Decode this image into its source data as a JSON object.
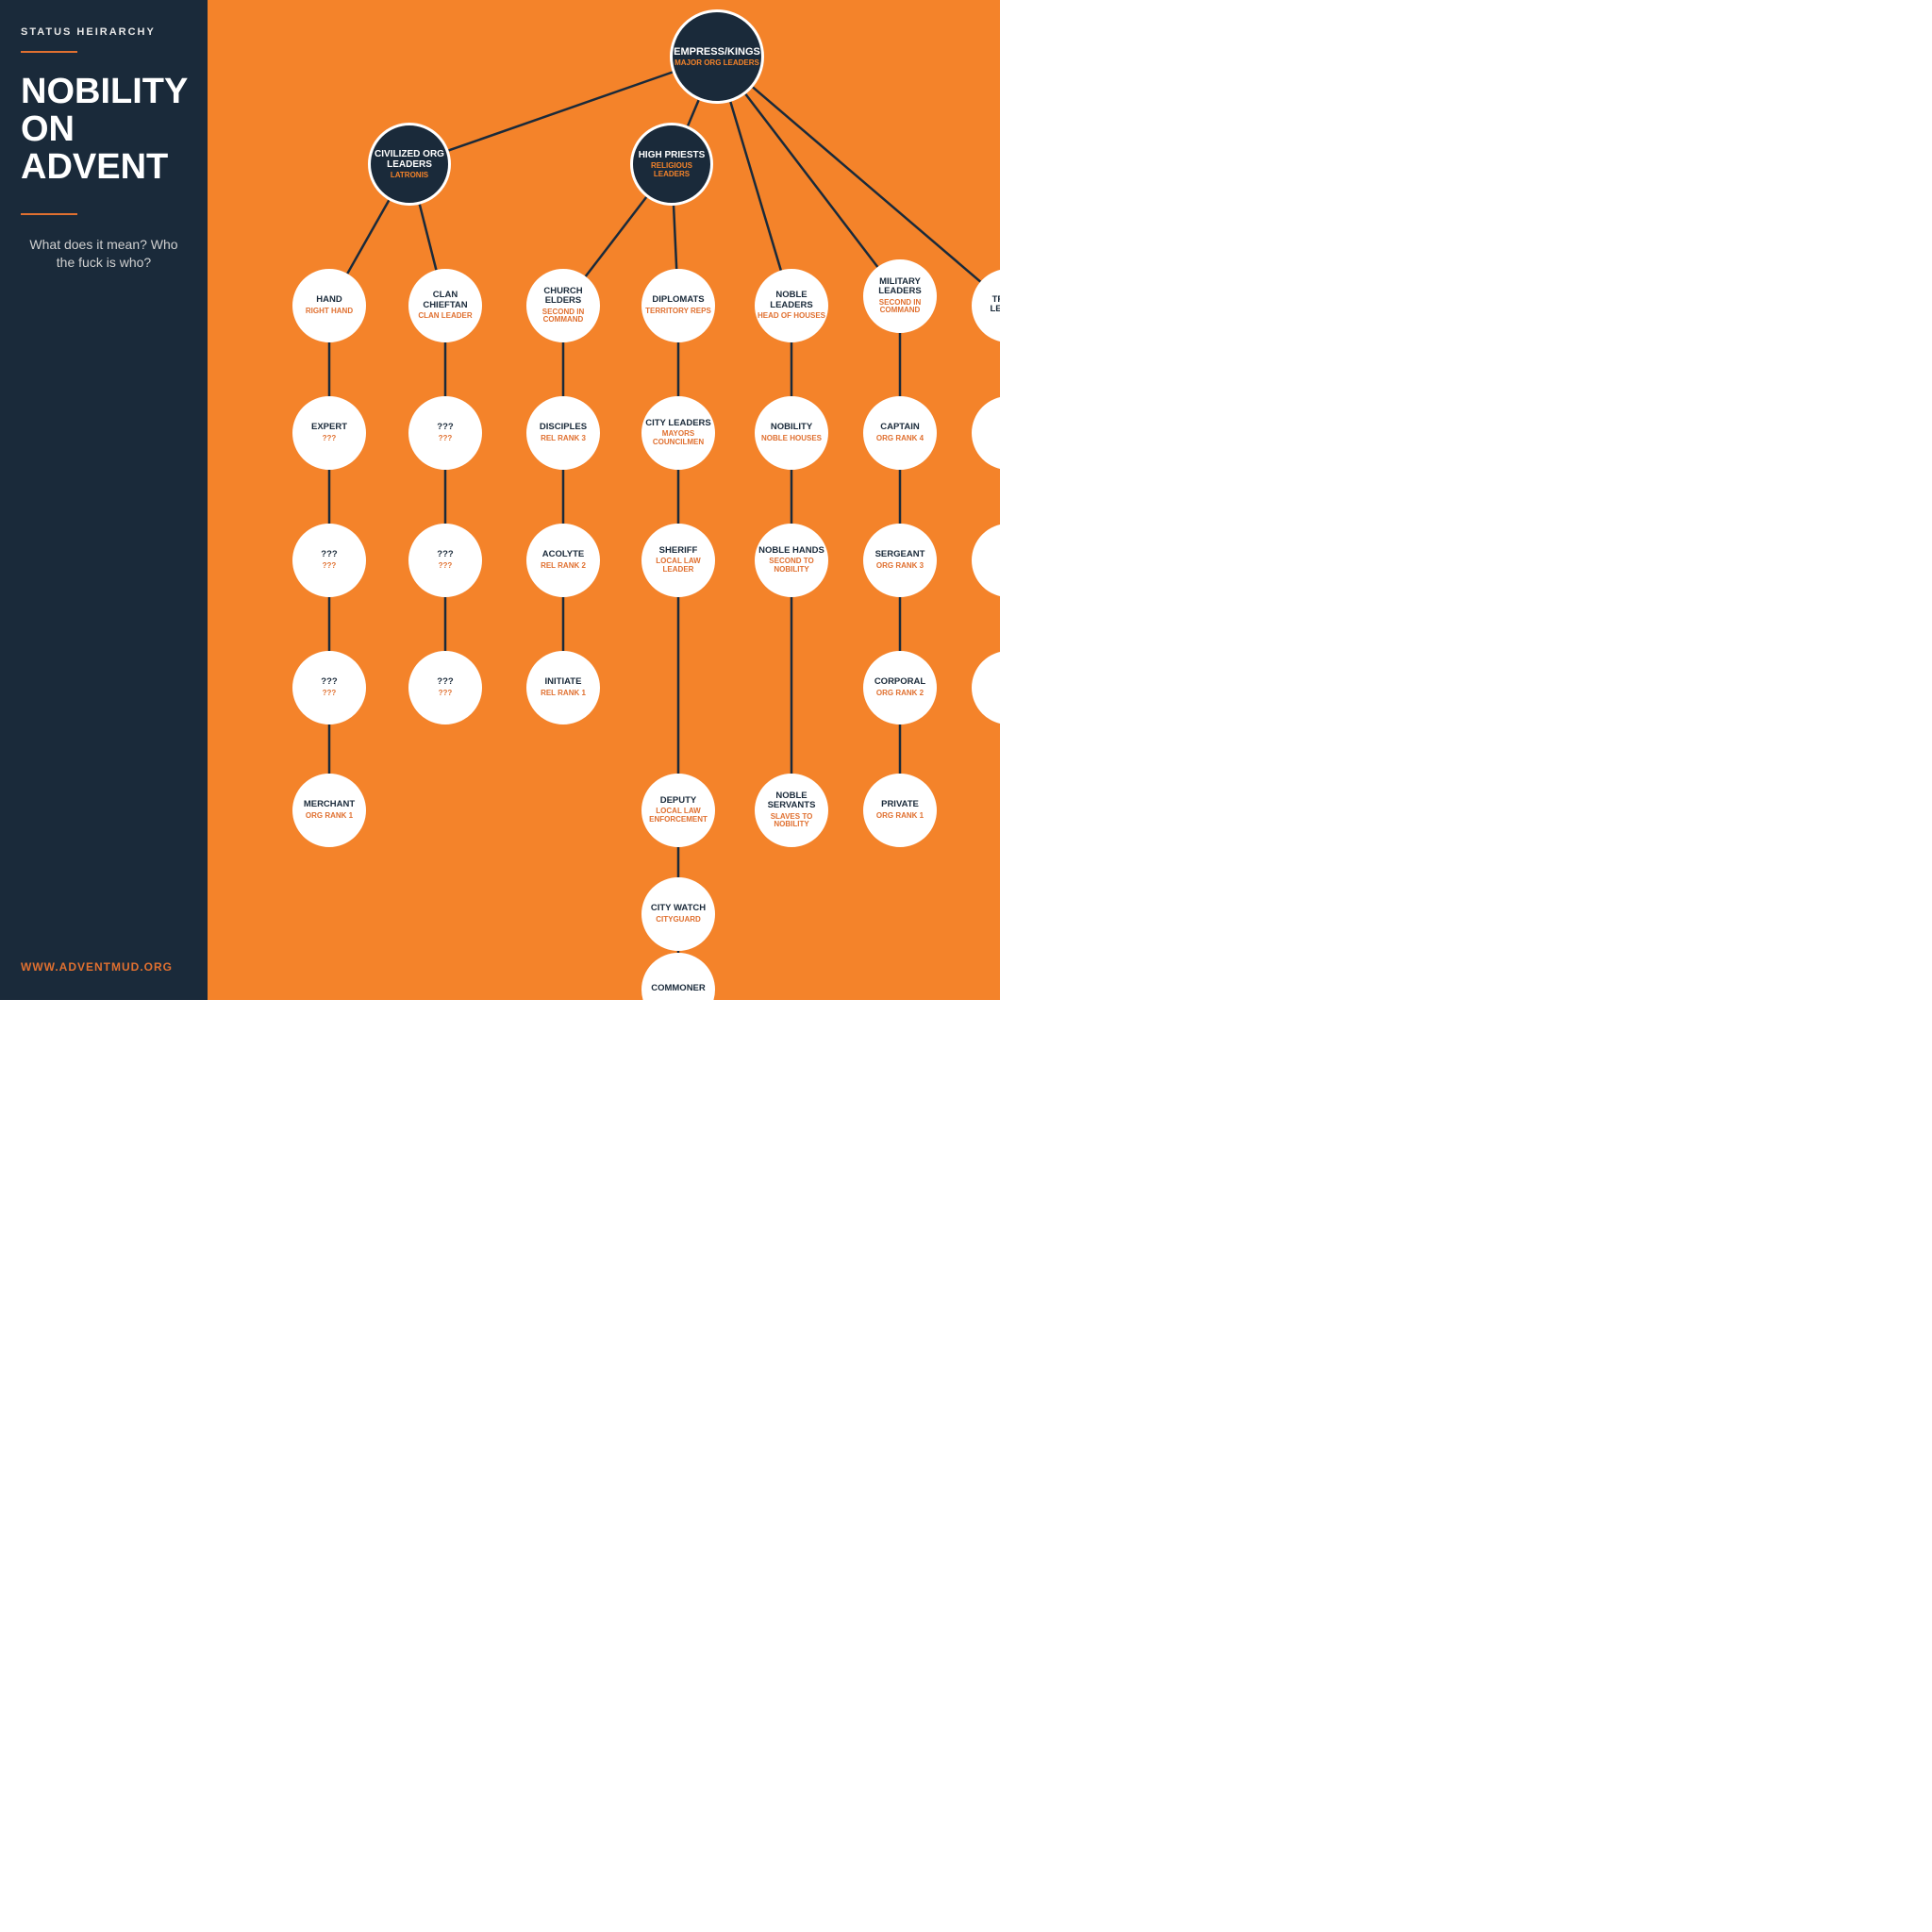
{
  "sidebar": {
    "status_label": "STATUS HEIRARCHY",
    "title": "NOBILITY ON ADVENT",
    "description": "What does it mean? Who the fuck is who?",
    "url": "WWW.ADVENTMUD.ORG"
  },
  "nodes": {
    "empress": {
      "title": "EMPRESS/KINGS",
      "sub": "MAJOR ORG\nLEADERS",
      "dark": true
    },
    "civilized": {
      "title": "CIVILIZED ORG LEADERS",
      "sub": "LATRONIS",
      "dark": true
    },
    "high_priests": {
      "title": "HIGH PRIESTS",
      "sub": "RELIGIOUS\nLEADERS",
      "dark": true
    },
    "hand": {
      "title": "HAND",
      "sub": "RIGHT HAND"
    },
    "clan_chieftan": {
      "title": "CLAN CHIEFTAN",
      "sub": "CLAN LEADER"
    },
    "church_elders": {
      "title": "CHURCH ELDERS",
      "sub": "SECOND IN\nCOMMAND"
    },
    "diplomats": {
      "title": "DIPLOMATS",
      "sub": "TERRITORY\nREPS"
    },
    "noble_leaders": {
      "title": "NOBLE LEADERS",
      "sub": "HEAD OF\nHOUSES"
    },
    "military_leaders": {
      "title": "MILITARY LEADERS",
      "sub": "SECOND IN\nCOMMAND"
    },
    "tribal_leader": {
      "title": "TRIBAL LEADER",
      "sub": ""
    },
    "expert": {
      "title": "EXPERT",
      "sub": "???"
    },
    "qqq_clan2": {
      "title": "???",
      "sub": "???"
    },
    "disciples": {
      "title": "DISCIPLES",
      "sub": "REL RANK 3"
    },
    "city_leaders": {
      "title": "CITY LEADERS",
      "sub": "MAYORS\nCOUNCILMEN"
    },
    "nobility": {
      "title": "NOBILITY",
      "sub": "NOBLE\nHOUSES"
    },
    "captain": {
      "title": "CAPTAIN",
      "sub": "ORG RANK 4"
    },
    "qqq_tribal2": {
      "title": "???",
      "sub": "???"
    },
    "qqq_3": {
      "title": "???",
      "sub": "???"
    },
    "qqq_clan3": {
      "title": "???",
      "sub": "???"
    },
    "acolyte": {
      "title": "ACOLYTE",
      "sub": "REL RANK 2"
    },
    "sheriff": {
      "title": "SHERIFF",
      "sub": "LOCAL LAW\nLEADER"
    },
    "noble_hands": {
      "title": "NOBLE HANDS",
      "sub": "SECOND TO\nNOBILITY"
    },
    "sergeant": {
      "title": "SERGEANT",
      "sub": "ORG RANK 3"
    },
    "qqq_tribal3": {
      "title": "???",
      "sub": "???"
    },
    "qqq_4": {
      "title": "???",
      "sub": "???"
    },
    "qqq_clan4": {
      "title": "???",
      "sub": "???"
    },
    "initiate": {
      "title": "INITIATE",
      "sub": "REL RANK 1"
    },
    "corporal": {
      "title": "CORPORAL",
      "sub": "ORG RANK 2"
    },
    "qqq_tribal4": {
      "title": "???",
      "sub": "???"
    },
    "merchant": {
      "title": "MERCHANT",
      "sub": "ORG RANK 1"
    },
    "deputy": {
      "title": "DEPUTY",
      "sub": "LOCAL LAW\nENFORCEMENT"
    },
    "noble_servants": {
      "title": "NOBLE\nSERVANTS",
      "sub": "SLAVES TO\nNOBILITY"
    },
    "private": {
      "title": "PRIVATE",
      "sub": "ORG RANK 1"
    },
    "city_watch": {
      "title": "CITY WATCH",
      "sub": "CITYGUARD"
    },
    "commoner": {
      "title": "COMMONER",
      "sub": ""
    }
  }
}
